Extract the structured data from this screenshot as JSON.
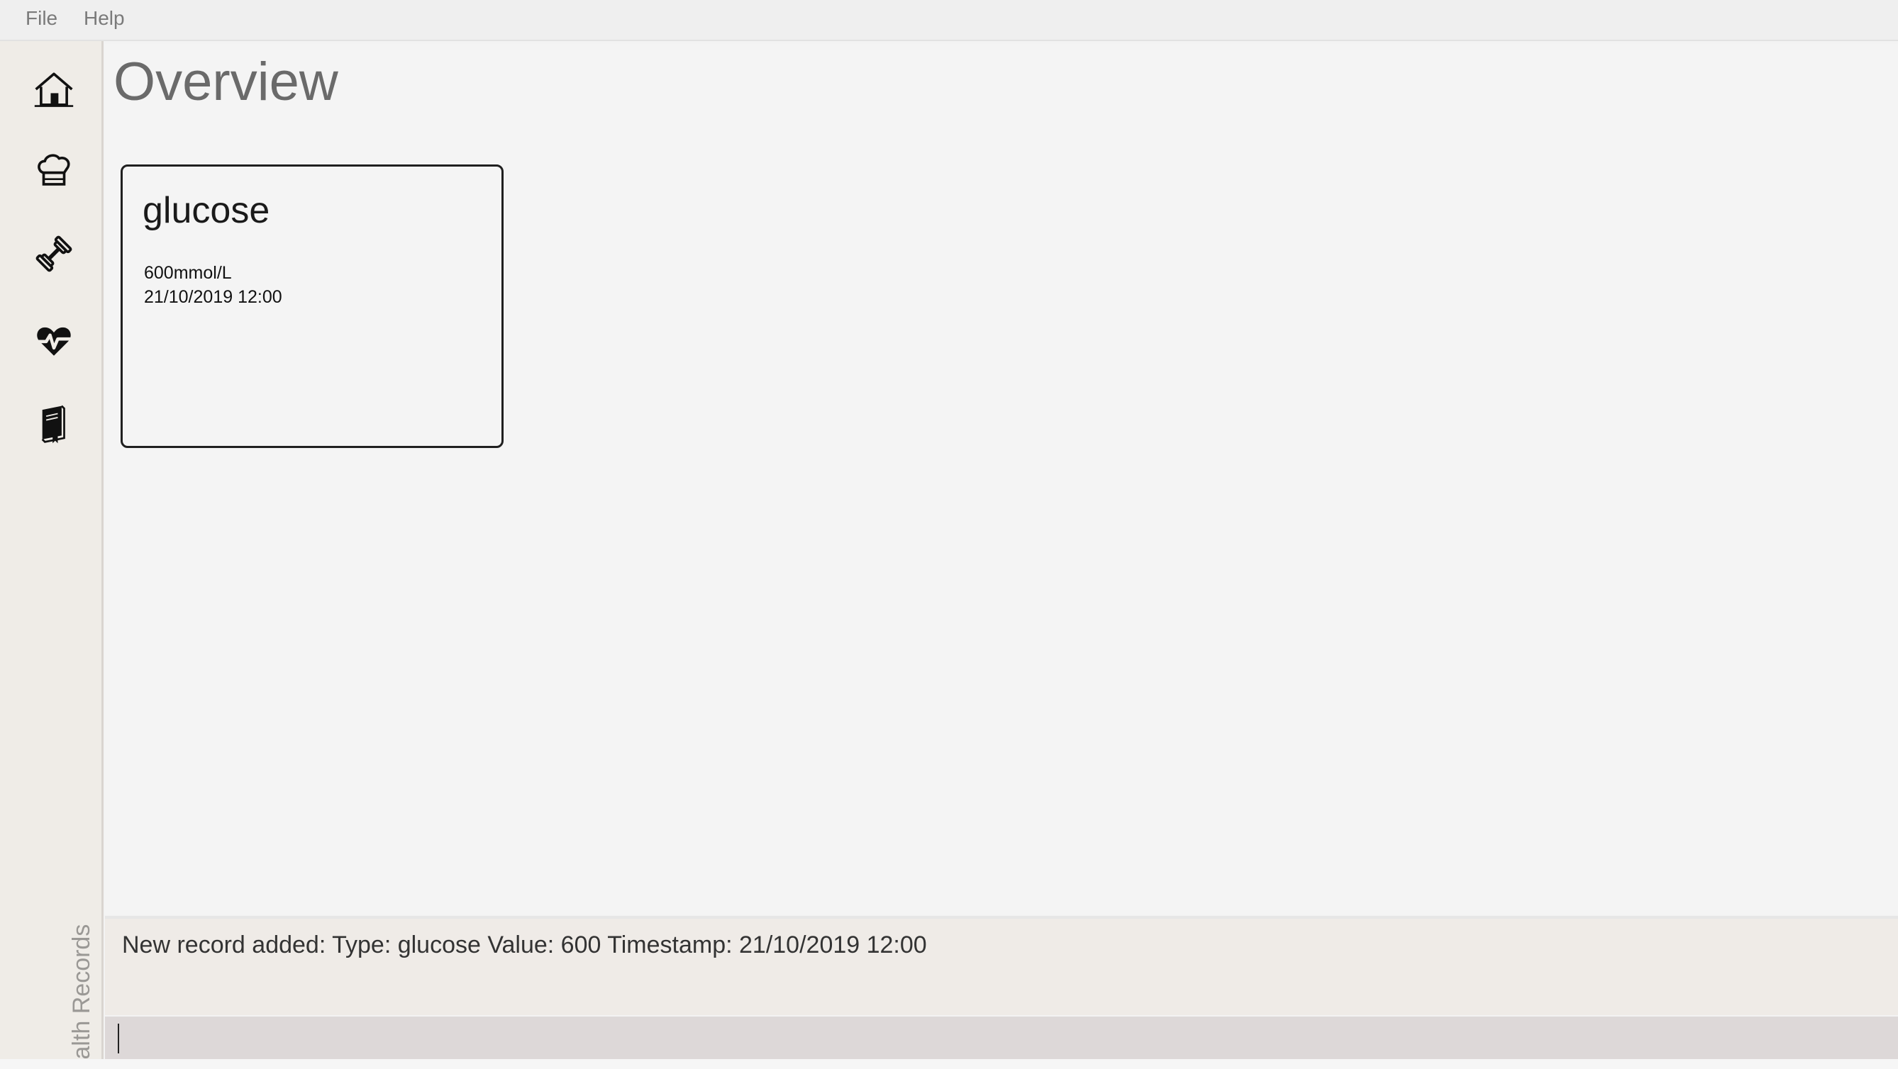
{
  "menubar": {
    "file_label": "File",
    "help_label": "Help"
  },
  "sidebar": {
    "items": [
      {
        "icon": "home-icon"
      },
      {
        "icon": "chef-hat-icon"
      },
      {
        "icon": "dumbbell-icon"
      },
      {
        "icon": "heartbeat-icon"
      },
      {
        "icon": "book-icon"
      }
    ],
    "vertical_label": "Health Records"
  },
  "main": {
    "title": "Overview",
    "cards": [
      {
        "type": "glucose",
        "value": "600mmol/L",
        "timestamp": "21/10/2019 12:00"
      }
    ]
  },
  "result_display": {
    "text": "New record added: Type: glucose Value: 600 Timestamp: 21/10/2019 12:00"
  },
  "command_box": {
    "value": ""
  }
}
